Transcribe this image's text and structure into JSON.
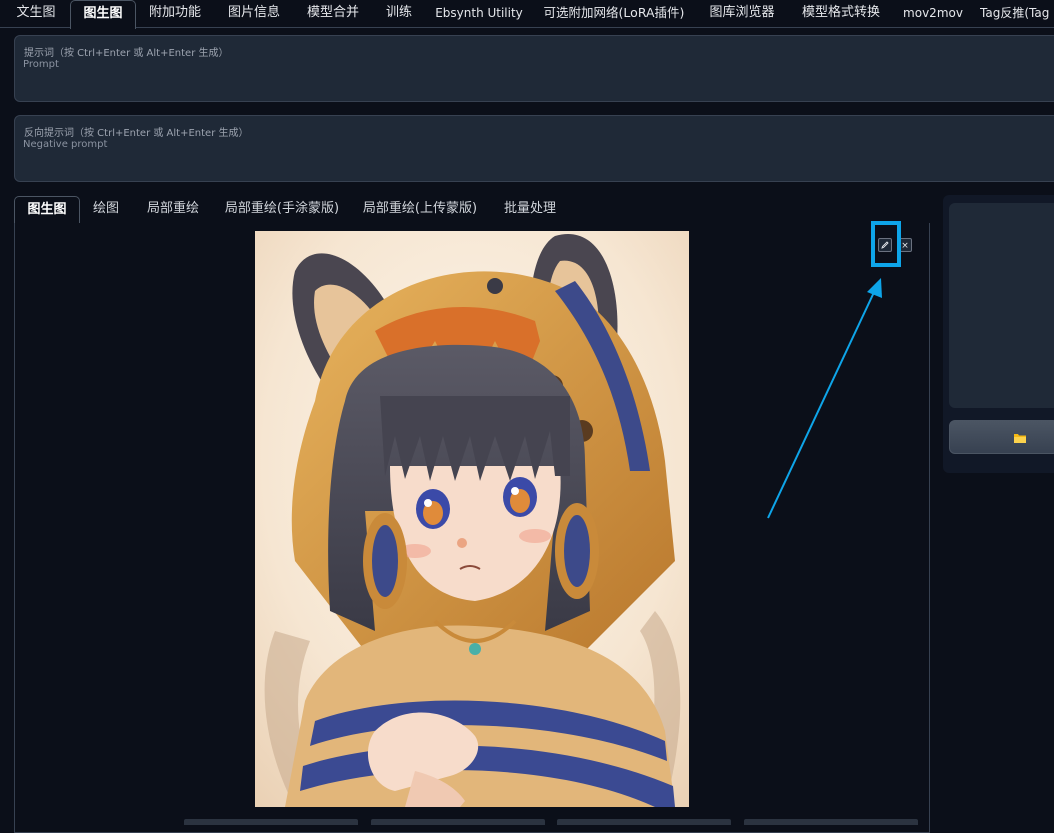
{
  "top_tabs": [
    {
      "label": "文生图",
      "active": false
    },
    {
      "label": "图生图",
      "active": true
    },
    {
      "label": "附加功能",
      "active": false
    },
    {
      "label": "图片信息",
      "active": false
    },
    {
      "label": "模型合并",
      "active": false
    },
    {
      "label": "训练",
      "active": false
    },
    {
      "label": "Ebsynth Utility",
      "active": false
    },
    {
      "label": "可选附加网络(LoRA插件)",
      "active": false
    },
    {
      "label": "图库浏览器",
      "active": false
    },
    {
      "label": "模型格式转换",
      "active": false
    },
    {
      "label": "mov2mov",
      "active": false
    },
    {
      "label": "Tag反推(Tag",
      "active": false
    }
  ],
  "prompt": {
    "label": "提示词（按 Ctrl+Enter 或 Alt+Enter 生成）",
    "placeholder": "Prompt"
  },
  "negative_prompt": {
    "label": "反向提示词（按 Ctrl+Enter 或 Alt+Enter 生成）",
    "placeholder": "Negative prompt"
  },
  "sub_tabs": [
    {
      "label": "图生图",
      "active": true
    },
    {
      "label": "绘图",
      "active": false
    },
    {
      "label": "局部重绘",
      "active": false
    },
    {
      "label": "局部重绘(手涂蒙版)",
      "active": false
    },
    {
      "label": "局部重绘(上传蒙版)",
      "active": false
    },
    {
      "label": "批量处理",
      "active": false
    }
  ],
  "image_tools": {
    "edit_icon": "pencil-icon",
    "close_icon": "close-icon",
    "close_glyph": "×"
  },
  "right_panel": {
    "folder_icon": "folder-icon"
  },
  "colors": {
    "highlight": "#0ea5e9",
    "background": "#0b0f19",
    "panel": "#1f2937"
  }
}
